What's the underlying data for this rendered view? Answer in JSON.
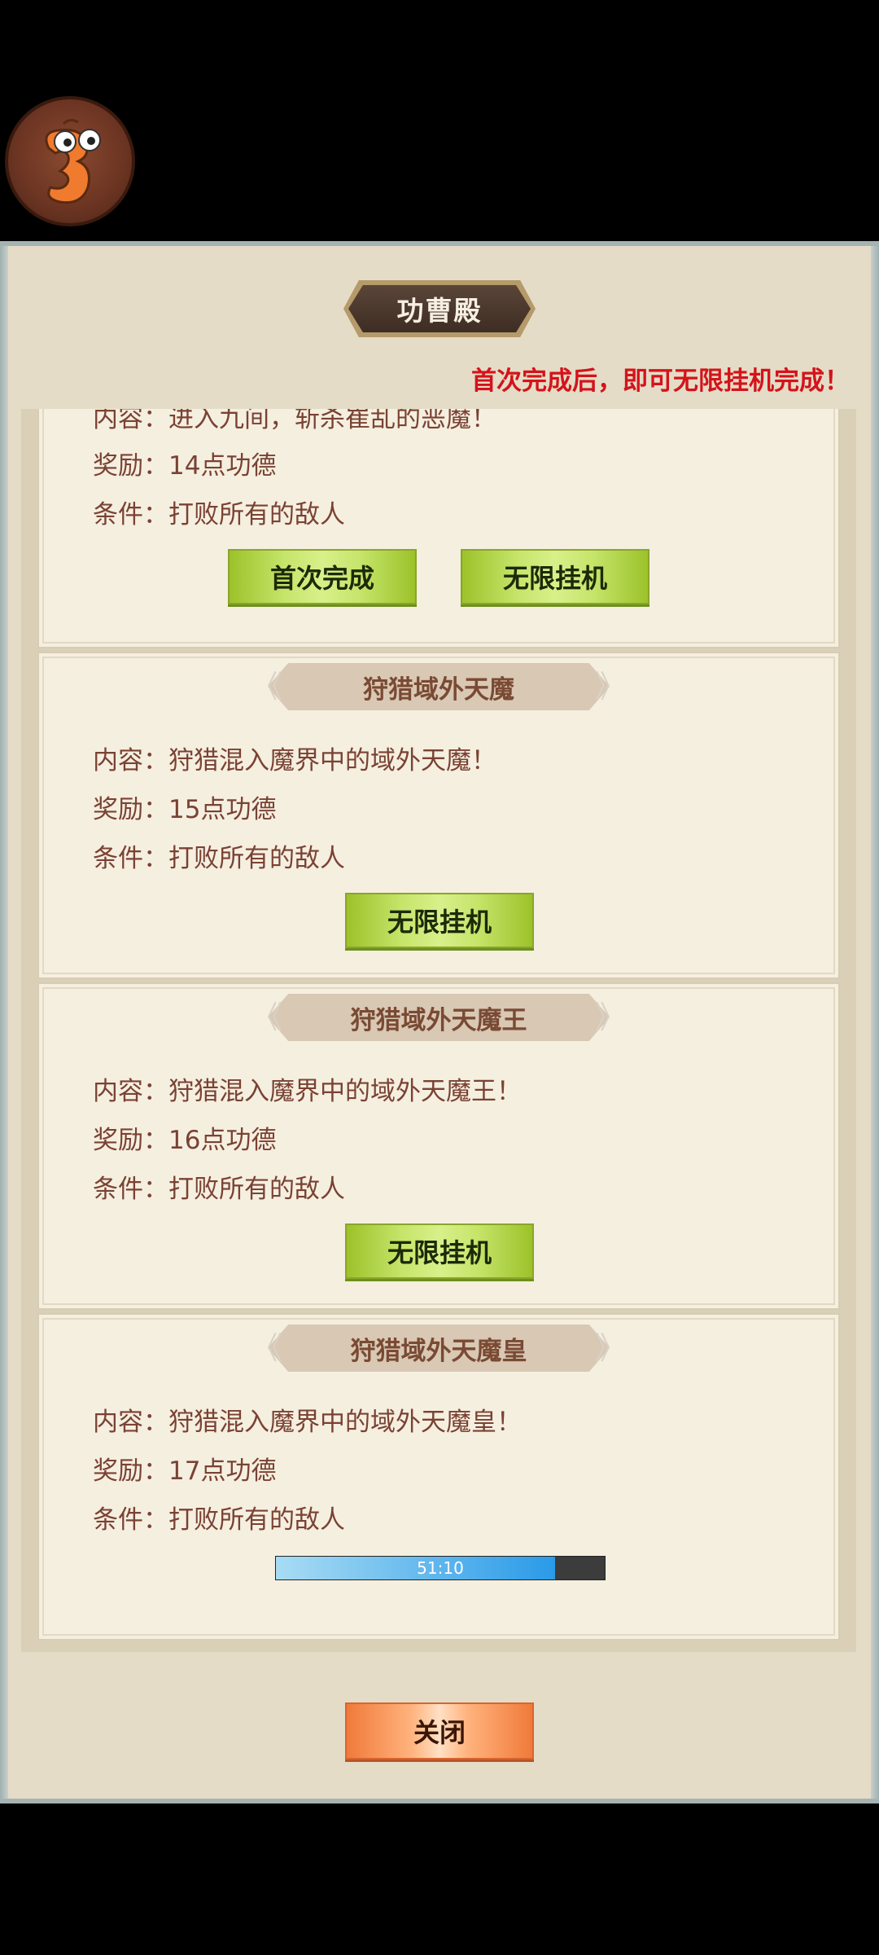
{
  "header": {
    "title": "功曹殿",
    "notice": "首次完成后，即可无限挂机完成！"
  },
  "avatar": {
    "icon": "cartoon-worm-avatar-icon"
  },
  "tasks": [
    {
      "title": "",
      "content_partial": "内容：进入九间，斩杀崔乱的恶魔！",
      "reward": "奖励：14点功德",
      "condition": "条件：打败所有的敌人",
      "buttons": [
        "首次完成",
        "无限挂机"
      ]
    },
    {
      "title": "狩猎域外天魔",
      "content": "内容：狩猎混入魔界中的域外天魔！",
      "reward": "奖励：15点功德",
      "condition": "条件：打败所有的敌人",
      "buttons": [
        "无限挂机"
      ]
    },
    {
      "title": "狩猎域外天魔王",
      "content": "内容：狩猎混入魔界中的域外天魔王！",
      "reward": "奖励：16点功德",
      "condition": "条件：打败所有的敌人",
      "buttons": [
        "无限挂机"
      ]
    },
    {
      "title": "狩猎域外天魔皇",
      "content": "内容：狩猎混入魔界中的域外天魔皇！",
      "reward": "奖励：17点功德",
      "condition": "条件：打败所有的敌人",
      "timer": {
        "label": "51:10",
        "progress": 0.85
      }
    }
  ],
  "footer": {
    "close_label": "关闭"
  },
  "colors": {
    "notice": "#d4131b",
    "text": "#7a4233",
    "button_green": "#c6e56b",
    "button_orange": "#ffb37e"
  }
}
